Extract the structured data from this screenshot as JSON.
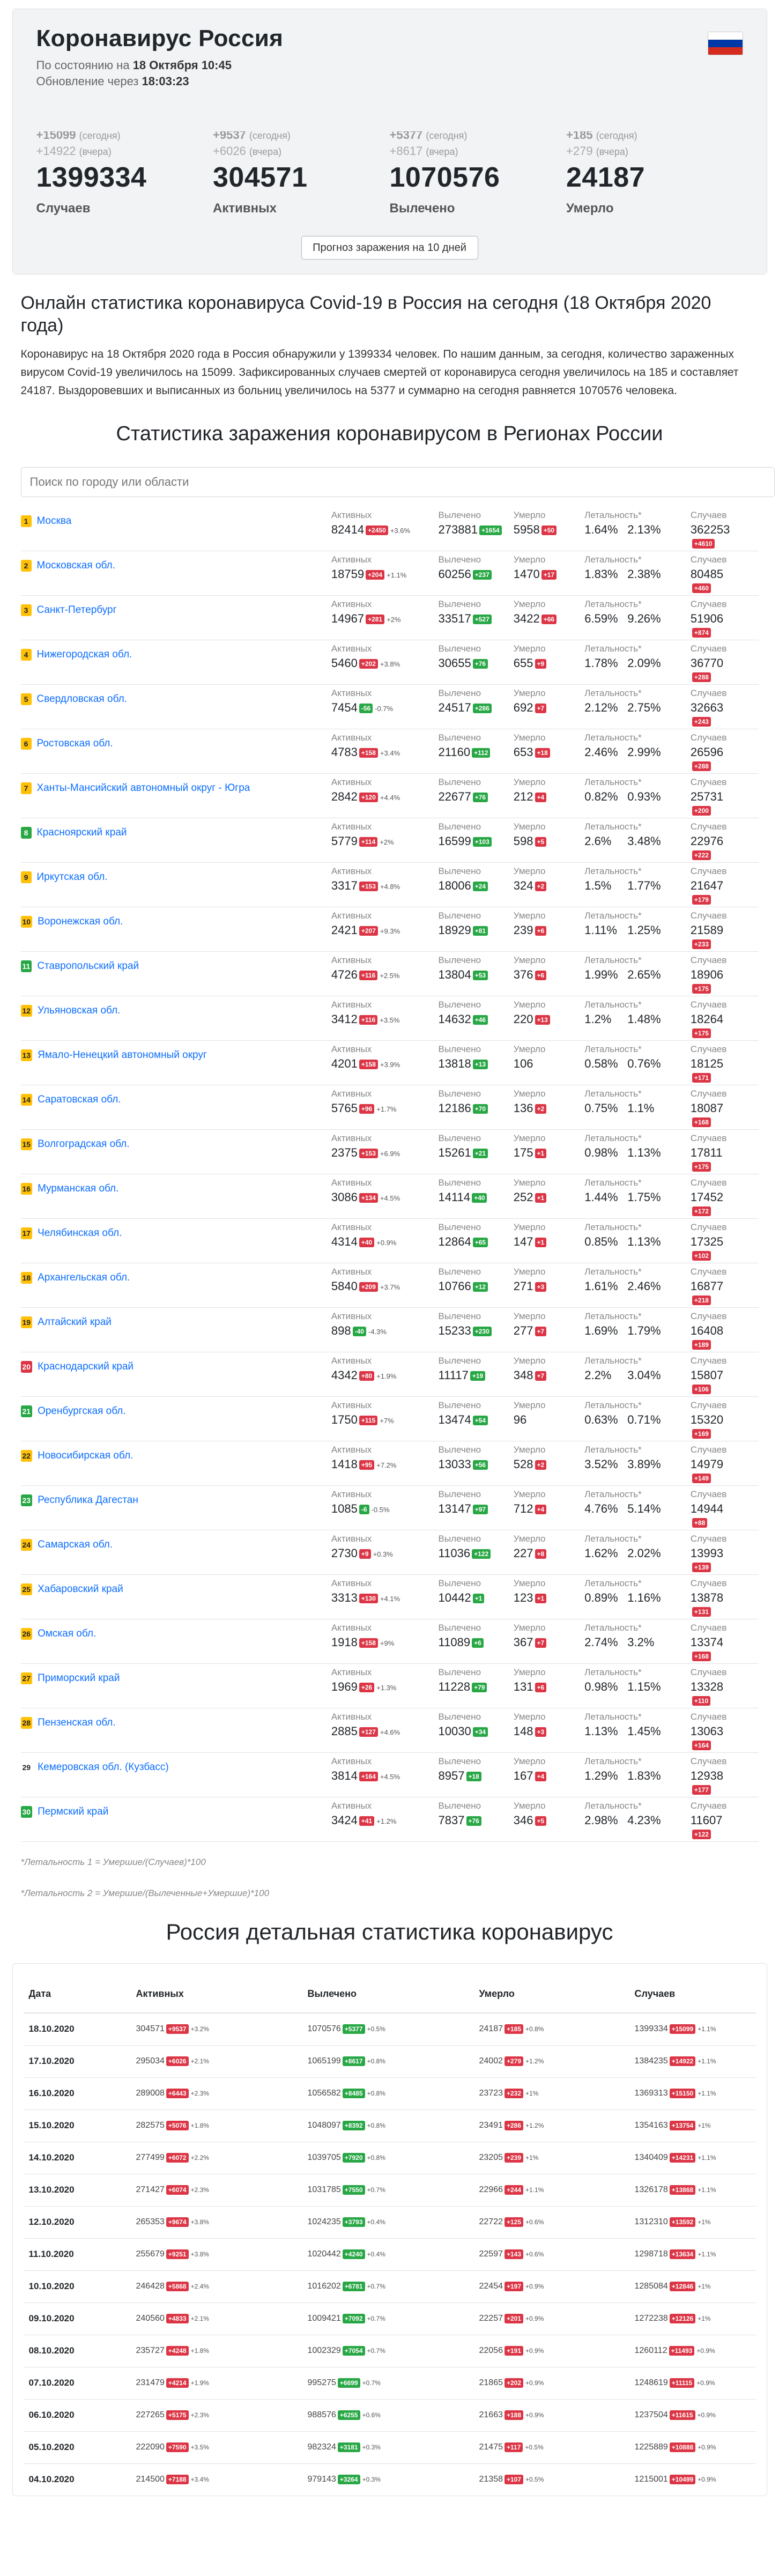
{
  "header": {
    "title": "Коронавирус Россия",
    "as_of_prefix": "По состоянию на",
    "as_of": "18 Октября 10:45",
    "update_prefix": "Обновление через",
    "update_in": "18:03:23"
  },
  "stats": [
    {
      "today": "+15099",
      "yesterday": "+14922",
      "today_label": "(сегодня)",
      "yesterday_label": "(вчера)",
      "total": "1399334",
      "label": "Случаев",
      "color": "black"
    },
    {
      "today": "+9537",
      "yesterday": "+6026",
      "today_label": "(сегодня)",
      "yesterday_label": "(вчера)",
      "total": "304571",
      "label": "Активных",
      "color": "blue"
    },
    {
      "today": "+5377",
      "yesterday": "+8617",
      "today_label": "(сегодня)",
      "yesterday_label": "(вчера)",
      "total": "1070576",
      "label": "Вылечено",
      "color": "green"
    },
    {
      "today": "+185",
      "yesterday": "+279",
      "today_label": "(сегодня)",
      "yesterday_label": "(вчера)",
      "total": "24187",
      "label": "Умерло",
      "color": "red"
    }
  ],
  "forecast_button": "Прогноз заражения на 10 дней",
  "article": {
    "title": "Онлайн статистика коронавируса Covid-19 в Россия на сегодня (18 Октября 2020 года)",
    "text": "Коронавирус на 18 Октября 2020 года в Россия обнаружили у 1399334 человек. По нашим данным, за сегодня, количество зараженных вирусом Covid-19 увеличилось на 15099. Зафиксированных случаев смертей от коронавируса сегодня увеличилось на 185 и составляет 24187. Выздоровевших и выписанных из больниц увеличилось на 5377 и суммарно на сегодня равняется 1070576 человека."
  },
  "regions_title": "Статистика заражения коронавирусом в Регионах России",
  "search_placeholder": "Поиск по городу или области",
  "col_labels": {
    "active": "Активных",
    "recovered": "Вылечено",
    "died": "Умерло",
    "lethality": "Летальность*",
    "cases": "Случаев"
  },
  "regions": [
    {
      "rank": "1",
      "rc": "y",
      "name": "Москва",
      "active": "82414",
      "ad": "+2450",
      "ap": "+3.6%",
      "rec": "273881",
      "rd": "+1654",
      "died": "5958",
      "dd": "+50",
      "l1": "1.64%",
      "l2": "2.13%",
      "cases": "362253",
      "cd": "+4610"
    },
    {
      "rank": "2",
      "rc": "y",
      "name": "Московская обл.",
      "active": "18759",
      "ad": "+204",
      "ap": "+1.1%",
      "rec": "60256",
      "rd": "+237",
      "died": "1470",
      "dd": "+17",
      "l1": "1.83%",
      "l2": "2.38%",
      "cases": "80485",
      "cd": "+460"
    },
    {
      "rank": "3",
      "rc": "y",
      "name": "Санкт-Петербург",
      "active": "14967",
      "ad": "+281",
      "ap": "+2%",
      "rec": "33517",
      "rd": "+527",
      "died": "3422",
      "dd": "+66",
      "l1": "6.59%",
      "l2": "9.26%",
      "cases": "51906",
      "cd": "+874"
    },
    {
      "rank": "4",
      "rc": "y",
      "name": "Нижегородская обл.",
      "active": "5460",
      "ad": "+202",
      "ap": "+3.8%",
      "rec": "30655",
      "rd": "+76",
      "died": "655",
      "dd": "+9",
      "l1": "1.78%",
      "l2": "2.09%",
      "cases": "36770",
      "cd": "+288"
    },
    {
      "rank": "5",
      "rc": "y",
      "name": "Свердловская обл.",
      "active": "7454",
      "ad": "-56",
      "ap": "-0.7%",
      "rec": "24517",
      "rd": "+286",
      "died": "692",
      "dd": "+7",
      "l1": "2.12%",
      "l2": "2.75%",
      "cases": "32663",
      "cd": "+243"
    },
    {
      "rank": "6",
      "rc": "y",
      "name": "Ростовская обл.",
      "active": "4783",
      "ad": "+158",
      "ap": "+3.4%",
      "rec": "21160",
      "rd": "+112",
      "died": "653",
      "dd": "+18",
      "l1": "2.46%",
      "l2": "2.99%",
      "cases": "26596",
      "cd": "+288"
    },
    {
      "rank": "7",
      "rc": "y",
      "name": "Ханты-Мансийский автономный округ - Югра",
      "active": "2842",
      "ad": "+120",
      "ap": "+4.4%",
      "rec": "22677",
      "rd": "+76",
      "died": "212",
      "dd": "+4",
      "l1": "0.82%",
      "l2": "0.93%",
      "cases": "25731",
      "cd": "+200"
    },
    {
      "rank": "8",
      "rc": "g",
      "name": "Красноярский край",
      "active": "5779",
      "ad": "+114",
      "ap": "+2%",
      "rec": "16599",
      "rd": "+103",
      "died": "598",
      "dd": "+5",
      "l1": "2.6%",
      "l2": "3.48%",
      "cases": "22976",
      "cd": "+222"
    },
    {
      "rank": "9",
      "rc": "y",
      "name": "Иркутская обл.",
      "active": "3317",
      "ad": "+153",
      "ap": "+4.8%",
      "rec": "18006",
      "rd": "+24",
      "died": "324",
      "dd": "+2",
      "l1": "1.5%",
      "l2": "1.77%",
      "cases": "21647",
      "cd": "+179"
    },
    {
      "rank": "10",
      "rc": "y",
      "name": "Воронежская обл.",
      "active": "2421",
      "ad": "+207",
      "ap": "+9.3%",
      "rec": "18929",
      "rd": "+81",
      "died": "239",
      "dd": "+6",
      "l1": "1.11%",
      "l2": "1.25%",
      "cases": "21589",
      "cd": "+233"
    },
    {
      "rank": "11",
      "rc": "g",
      "name": "Ставропольский край",
      "active": "4726",
      "ad": "+116",
      "ap": "+2.5%",
      "rec": "13804",
      "rd": "+53",
      "died": "376",
      "dd": "+6",
      "l1": "1.99%",
      "l2": "2.65%",
      "cases": "18906",
      "cd": "+175"
    },
    {
      "rank": "12",
      "rc": "y",
      "name": "Ульяновская обл.",
      "active": "3412",
      "ad": "+116",
      "ap": "+3.5%",
      "rec": "14632",
      "rd": "+46",
      "died": "220",
      "dd": "+13",
      "l1": "1.2%",
      "l2": "1.48%",
      "cases": "18264",
      "cd": "+175"
    },
    {
      "rank": "13",
      "rc": "y",
      "name": "Ямало-Ненецкий автономный округ",
      "active": "4201",
      "ad": "+158",
      "ap": "+3.9%",
      "rec": "13818",
      "rd": "+13",
      "died": "106",
      "dd": "",
      "l1": "0.58%",
      "l2": "0.76%",
      "cases": "18125",
      "cd": "+171"
    },
    {
      "rank": "14",
      "rc": "y",
      "name": "Саратовская обл.",
      "active": "5765",
      "ad": "+96",
      "ap": "+1.7%",
      "rec": "12186",
      "rd": "+70",
      "died": "136",
      "dd": "+2",
      "l1": "0.75%",
      "l2": "1.1%",
      "cases": "18087",
      "cd": "+168"
    },
    {
      "rank": "15",
      "rc": "y",
      "name": "Волгоградская обл.",
      "active": "2375",
      "ad": "+153",
      "ap": "+6.9%",
      "rec": "15261",
      "rd": "+21",
      "died": "175",
      "dd": "+1",
      "l1": "0.98%",
      "l2": "1.13%",
      "cases": "17811",
      "cd": "+175"
    },
    {
      "rank": "16",
      "rc": "y",
      "name": "Мурманская обл.",
      "active": "3086",
      "ad": "+134",
      "ap": "+4.5%",
      "rec": "14114",
      "rd": "+40",
      "died": "252",
      "dd": "+1",
      "l1": "1.44%",
      "l2": "1.75%",
      "cases": "17452",
      "cd": "+172"
    },
    {
      "rank": "17",
      "rc": "y",
      "name": "Челябинская обл.",
      "active": "4314",
      "ad": "+40",
      "ap": "+0.9%",
      "rec": "12864",
      "rd": "+65",
      "died": "147",
      "dd": "+1",
      "l1": "0.85%",
      "l2": "1.13%",
      "cases": "17325",
      "cd": "+102"
    },
    {
      "rank": "18",
      "rc": "y",
      "name": "Архангельская обл.",
      "active": "5840",
      "ad": "+209",
      "ap": "+3.7%",
      "rec": "10766",
      "rd": "+12",
      "died": "271",
      "dd": "+3",
      "l1": "1.61%",
      "l2": "2.46%",
      "cases": "16877",
      "cd": "+218"
    },
    {
      "rank": "19",
      "rc": "y",
      "name": "Алтайский край",
      "active": "898",
      "ad": "-40",
      "ap": "-4.3%",
      "rec": "15233",
      "rd": "+230",
      "died": "277",
      "dd": "+7",
      "l1": "1.69%",
      "l2": "1.79%",
      "cases": "16408",
      "cd": "+189"
    },
    {
      "rank": "20",
      "rc": "r",
      "name": "Краснодарский край",
      "active": "4342",
      "ad": "+80",
      "ap": "+1.9%",
      "rec": "11117",
      "rd": "+19",
      "died": "348",
      "dd": "+7",
      "l1": "2.2%",
      "l2": "3.04%",
      "cases": "15807",
      "cd": "+106"
    },
    {
      "rank": "21",
      "rc": "g",
      "name": "Оренбургская обл.",
      "active": "1750",
      "ad": "+115",
      "ap": "+7%",
      "rec": "13474",
      "rd": "+54",
      "died": "96",
      "dd": "",
      "l1": "0.63%",
      "l2": "0.71%",
      "cases": "15320",
      "cd": "+169"
    },
    {
      "rank": "22",
      "rc": "y",
      "name": "Новосибирская обл.",
      "active": "1418",
      "ad": "+95",
      "ap": "+7.2%",
      "rec": "13033",
      "rd": "+56",
      "died": "528",
      "dd": "+2",
      "l1": "3.52%",
      "l2": "3.89%",
      "cases": "14979",
      "cd": "+149"
    },
    {
      "rank": "23",
      "rc": "g",
      "name": "Республика Дагестан",
      "active": "1085",
      "ad": "-6",
      "ap": "-0.5%",
      "rec": "13147",
      "rd": "+97",
      "died": "712",
      "dd": "+4",
      "l1": "4.76%",
      "l2": "5.14%",
      "cases": "14944",
      "cd": "+88"
    },
    {
      "rank": "24",
      "rc": "y",
      "name": "Самарская обл.",
      "active": "2730",
      "ad": "+9",
      "ap": "+0.3%",
      "rec": "11036",
      "rd": "+122",
      "died": "227",
      "dd": "+8",
      "l1": "1.62%",
      "l2": "2.02%",
      "cases": "13993",
      "cd": "+139"
    },
    {
      "rank": "25",
      "rc": "y",
      "name": "Хабаровский край",
      "active": "3313",
      "ad": "+130",
      "ap": "+4.1%",
      "rec": "10442",
      "rd": "+1",
      "died": "123",
      "dd": "+1",
      "l1": "0.89%",
      "l2": "1.16%",
      "cases": "13878",
      "cd": "+131"
    },
    {
      "rank": "26",
      "rc": "y",
      "name": "Омская обл.",
      "active": "1918",
      "ad": "+158",
      "ap": "+9%",
      "rec": "11089",
      "rd": "+6",
      "died": "367",
      "dd": "+7",
      "l1": "2.74%",
      "l2": "3.2%",
      "cases": "13374",
      "cd": "+168"
    },
    {
      "rank": "27",
      "rc": "y",
      "name": "Приморский край",
      "active": "1969",
      "ad": "+26",
      "ap": "+1.3%",
      "rec": "11228",
      "rd": "+79",
      "died": "131",
      "dd": "+6",
      "l1": "0.98%",
      "l2": "1.15%",
      "cases": "13328",
      "cd": "+110"
    },
    {
      "rank": "28",
      "rc": "y",
      "name": "Пензенская обл.",
      "active": "2885",
      "ad": "+127",
      "ap": "+4.6%",
      "rec": "10030",
      "rd": "+34",
      "died": "148",
      "dd": "+3",
      "l1": "1.13%",
      "l2": "1.45%",
      "cases": "13063",
      "cd": "+164"
    },
    {
      "rank": "29",
      "rc": "n",
      "name": "Кемеровская обл. (Кузбасс)",
      "active": "3814",
      "ad": "+164",
      "ap": "+4.5%",
      "rec": "8957",
      "rd": "+18",
      "died": "167",
      "dd": "+4",
      "l1": "1.29%",
      "l2": "1.83%",
      "cases": "12938",
      "cd": "+177"
    },
    {
      "rank": "30",
      "rc": "g",
      "name": "Пермский край",
      "active": "3424",
      "ad": "+41",
      "ap": "+1.2%",
      "rec": "7837",
      "rd": "+76",
      "died": "346",
      "dd": "+5",
      "l1": "2.98%",
      "l2": "4.23%",
      "cases": "11607",
      "cd": "+122"
    }
  ],
  "notes": [
    "*Летальность 1 = Умершие/(Случаев)*100",
    "*Летальность 2 = Умершие/(Вылеченные+Умершие)*100"
  ],
  "detail_title": "Россия детальная статистика коронавирус",
  "detail_headers": {
    "date": "Дата",
    "active": "Активных",
    "recovered": "Вылечено",
    "died": "Умерло",
    "cases": "Случаев"
  },
  "detail_rows": [
    {
      "date": "18.10.2020",
      "a": "304571",
      "ad": "+9537",
      "ap": "+3.2%",
      "ac": "r",
      "r": "1070576",
      "rd": "+5377",
      "rp": "+0.5%",
      "d": "24187",
      "dd": "+185",
      "dp": "+0.8%",
      "c": "1399334",
      "cd": "+15099",
      "cp": "+1.1%"
    },
    {
      "date": "17.10.2020",
      "a": "295034",
      "ad": "+6026",
      "ap": "+2.1%",
      "ac": "r",
      "r": "1065199",
      "rd": "+8617",
      "rp": "+0.8%",
      "d": "24002",
      "dd": "+279",
      "dp": "+1.2%",
      "c": "1384235",
      "cd": "+14922",
      "cp": "+1.1%"
    },
    {
      "date": "16.10.2020",
      "a": "289008",
      "ad": "+6443",
      "ap": "+2.3%",
      "ac": "r",
      "r": "1056582",
      "rd": "+8485",
      "rp": "+0.8%",
      "d": "23723",
      "dd": "+232",
      "dp": "+1%",
      "c": "1369313",
      "cd": "+15150",
      "cp": "+1.1%"
    },
    {
      "date": "15.10.2020",
      "a": "282575",
      "ad": "+5076",
      "ap": "+1.8%",
      "ac": "r",
      "r": "1048097",
      "rd": "+8392",
      "rp": "+0.8%",
      "d": "23491",
      "dd": "+286",
      "dp": "+1.2%",
      "c": "1354163",
      "cd": "+13754",
      "cp": "+1%"
    },
    {
      "date": "14.10.2020",
      "a": "277499",
      "ad": "+6072",
      "ap": "+2.2%",
      "ac": "r",
      "r": "1039705",
      "rd": "+7920",
      "rp": "+0.8%",
      "d": "23205",
      "dd": "+239",
      "dp": "+1%",
      "c": "1340409",
      "cd": "+14231",
      "cp": "+1.1%"
    },
    {
      "date": "13.10.2020",
      "a": "271427",
      "ad": "+6074",
      "ap": "+2.3%",
      "ac": "r",
      "r": "1031785",
      "rd": "+7550",
      "rp": "+0.7%",
      "d": "22966",
      "dd": "+244",
      "dp": "+1.1%",
      "c": "1326178",
      "cd": "+13868",
      "cp": "+1.1%"
    },
    {
      "date": "12.10.2020",
      "a": "265353",
      "ad": "+9674",
      "ap": "+3.8%",
      "ac": "r",
      "r": "1024235",
      "rd": "+3793",
      "rp": "+0.4%",
      "d": "22722",
      "dd": "+125",
      "dp": "+0.6%",
      "c": "1312310",
      "cd": "+13592",
      "cp": "+1%"
    },
    {
      "date": "11.10.2020",
      "a": "255679",
      "ad": "+9251",
      "ap": "+3.8%",
      "ac": "r",
      "r": "1020442",
      "rd": "+4240",
      "rp": "+0.4%",
      "d": "22597",
      "dd": "+143",
      "dp": "+0.6%",
      "c": "1298718",
      "cd": "+13634",
      "cp": "+1.1%"
    },
    {
      "date": "10.10.2020",
      "a": "246428",
      "ad": "+5868",
      "ap": "+2.4%",
      "ac": "r",
      "r": "1016202",
      "rd": "+6781",
      "rp": "+0.7%",
      "d": "22454",
      "dd": "+197",
      "dp": "+0.9%",
      "c": "1285084",
      "cd": "+12846",
      "cp": "+1%"
    },
    {
      "date": "09.10.2020",
      "a": "240560",
      "ad": "+4833",
      "ap": "+2.1%",
      "ac": "r",
      "r": "1009421",
      "rd": "+7092",
      "rp": "+0.7%",
      "d": "22257",
      "dd": "+201",
      "dp": "+0.9%",
      "c": "1272238",
      "cd": "+12126",
      "cp": "+1%"
    },
    {
      "date": "08.10.2020",
      "a": "235727",
      "ad": "+4248",
      "ap": "+1.8%",
      "ac": "r",
      "r": "1002329",
      "rd": "+7054",
      "rp": "+0.7%",
      "d": "22056",
      "dd": "+191",
      "dp": "+0.9%",
      "c": "1260112",
      "cd": "+11493",
      "cp": "+0.9%"
    },
    {
      "date": "07.10.2020",
      "a": "231479",
      "ad": "+4214",
      "ap": "+1.9%",
      "ac": "r",
      "r": "995275",
      "rd": "+6699",
      "rp": "+0.7%",
      "d": "21865",
      "dd": "+202",
      "dp": "+0.9%",
      "c": "1248619",
      "cd": "+11115",
      "cp": "+0.9%"
    },
    {
      "date": "06.10.2020",
      "a": "227265",
      "ad": "+5175",
      "ap": "+2.3%",
      "ac": "r",
      "r": "988576",
      "rd": "+6255",
      "rp": "+0.6%",
      "d": "21663",
      "dd": "+188",
      "dp": "+0.9%",
      "c": "1237504",
      "cd": "+11615",
      "cp": "+0.9%"
    },
    {
      "date": "05.10.2020",
      "a": "222090",
      "ad": "+7590",
      "ap": "+3.5%",
      "ac": "r",
      "r": "982324",
      "rd": "+3181",
      "rp": "+0.3%",
      "d": "21475",
      "dd": "+117",
      "dp": "+0.5%",
      "c": "1225889",
      "cd": "+10888",
      "cp": "+0.9%"
    },
    {
      "date": "04.10.2020",
      "a": "214500",
      "ad": "+7188",
      "ap": "+3.4%",
      "ac": "r",
      "r": "979143",
      "rd": "+3264",
      "rp": "+0.3%",
      "d": "21358",
      "dd": "+107",
      "dp": "+0.5%",
      "c": "1215001",
      "cd": "+10499",
      "cp": "+0.9%"
    }
  ],
  "colors": {
    "red": "#dc3545",
    "green": "#28a745",
    "blue": "#1e88e5",
    "yellow": "#ffc107",
    "flag_white": "#ffffff",
    "flag_blue": "#0039a6",
    "flag_red": "#d52b1e"
  }
}
